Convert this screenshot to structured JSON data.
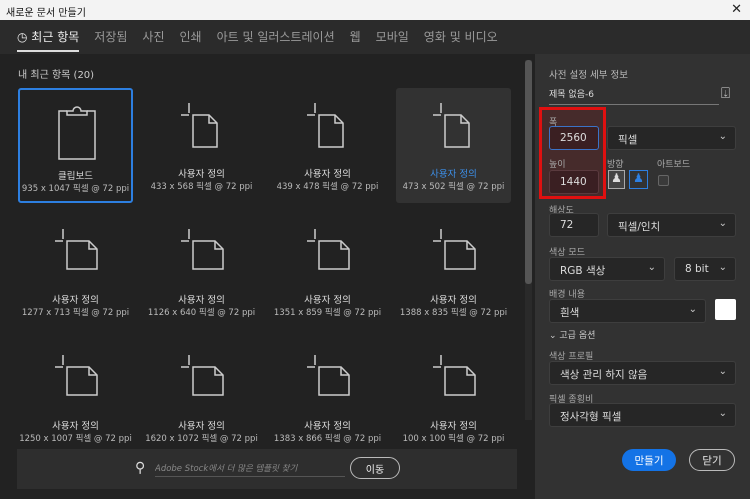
{
  "window": {
    "title": "새로운 문서 만들기",
    "close": "✕"
  },
  "tabs": [
    "최근 항목",
    "저장됨",
    "사진",
    "인쇄",
    "아트 및 일러스트레이션",
    "웹",
    "모바일",
    "영화 및 비디오"
  ],
  "recent": {
    "heading": "내 최근 항목",
    "count": "(20)",
    "items": [
      {
        "name": "클립보드",
        "dims": "935 x 1047 픽셀 @ 72 ppi",
        "icon": "clipboard"
      },
      {
        "name": "사용자 정의",
        "dims": "433 x 568 픽셀 @ 72 ppi",
        "icon": "doc"
      },
      {
        "name": "사용자 정의",
        "dims": "439 x 478 픽셀 @ 72 ppi",
        "icon": "doc"
      },
      {
        "name": "사용자 정의",
        "dims": "473 x 502 픽셀 @ 72 ppi",
        "icon": "doc"
      },
      {
        "name": "사용자 정의",
        "dims": "1277 x 713 픽셀 @ 72 ppi",
        "icon": "doc-landscape"
      },
      {
        "name": "사용자 정의",
        "dims": "1126 x 640 픽셀 @ 72 ppi",
        "icon": "doc-landscape"
      },
      {
        "name": "사용자 정의",
        "dims": "1351 x 859 픽셀 @ 72 ppi",
        "icon": "doc-landscape"
      },
      {
        "name": "사용자 정의",
        "dims": "1388 x 835 픽셀 @ 72 ppi",
        "icon": "doc-landscape"
      },
      {
        "name": "사용자 정의",
        "dims": "1250 x 1007 픽셀 @ 72 ppi",
        "icon": "doc-landscape"
      },
      {
        "name": "사용자 정의",
        "dims": "1620 x 1072 픽셀 @ 72 ppi",
        "icon": "doc-landscape"
      },
      {
        "name": "사용자 정의",
        "dims": "1383 x 866 픽셀 @ 72 ppi",
        "icon": "doc-landscape"
      },
      {
        "name": "사용자 정의",
        "dims": "100 x 100 픽셀 @ 72 ppi",
        "icon": "doc-landscape"
      }
    ]
  },
  "stock": {
    "placeholder": "Adobe Stock에서 더 많은 템플릿 찾기",
    "go": "이동"
  },
  "preset": {
    "heading": "사전 설정 세부 정보",
    "name": "제목 없음-6",
    "width_label": "폭",
    "width": "2560",
    "unit": "픽셀",
    "height_label": "높이",
    "height": "1440",
    "orientation_label": "방향",
    "artboard_label": "아트보드",
    "resolution_label": "해상도",
    "resolution": "72",
    "resolution_unit": "픽셀/인치",
    "color_mode_label": "색상 모드",
    "color_mode": "RGB 색상",
    "bit_depth": "8 bit",
    "background_label": "배경 내용",
    "background": "흰색",
    "background_color": "#ffffff",
    "advanced": "고급 옵션",
    "profile_label": "색상 프로필",
    "profile": "색상 관리 하지 않음",
    "aspect_label": "픽셀 종횡비",
    "aspect": "정사각형 픽셀"
  },
  "buttons": {
    "create": "만들기",
    "close": "닫기"
  },
  "colors": {
    "accent": "#1473e6",
    "highlight": "#e01010"
  }
}
